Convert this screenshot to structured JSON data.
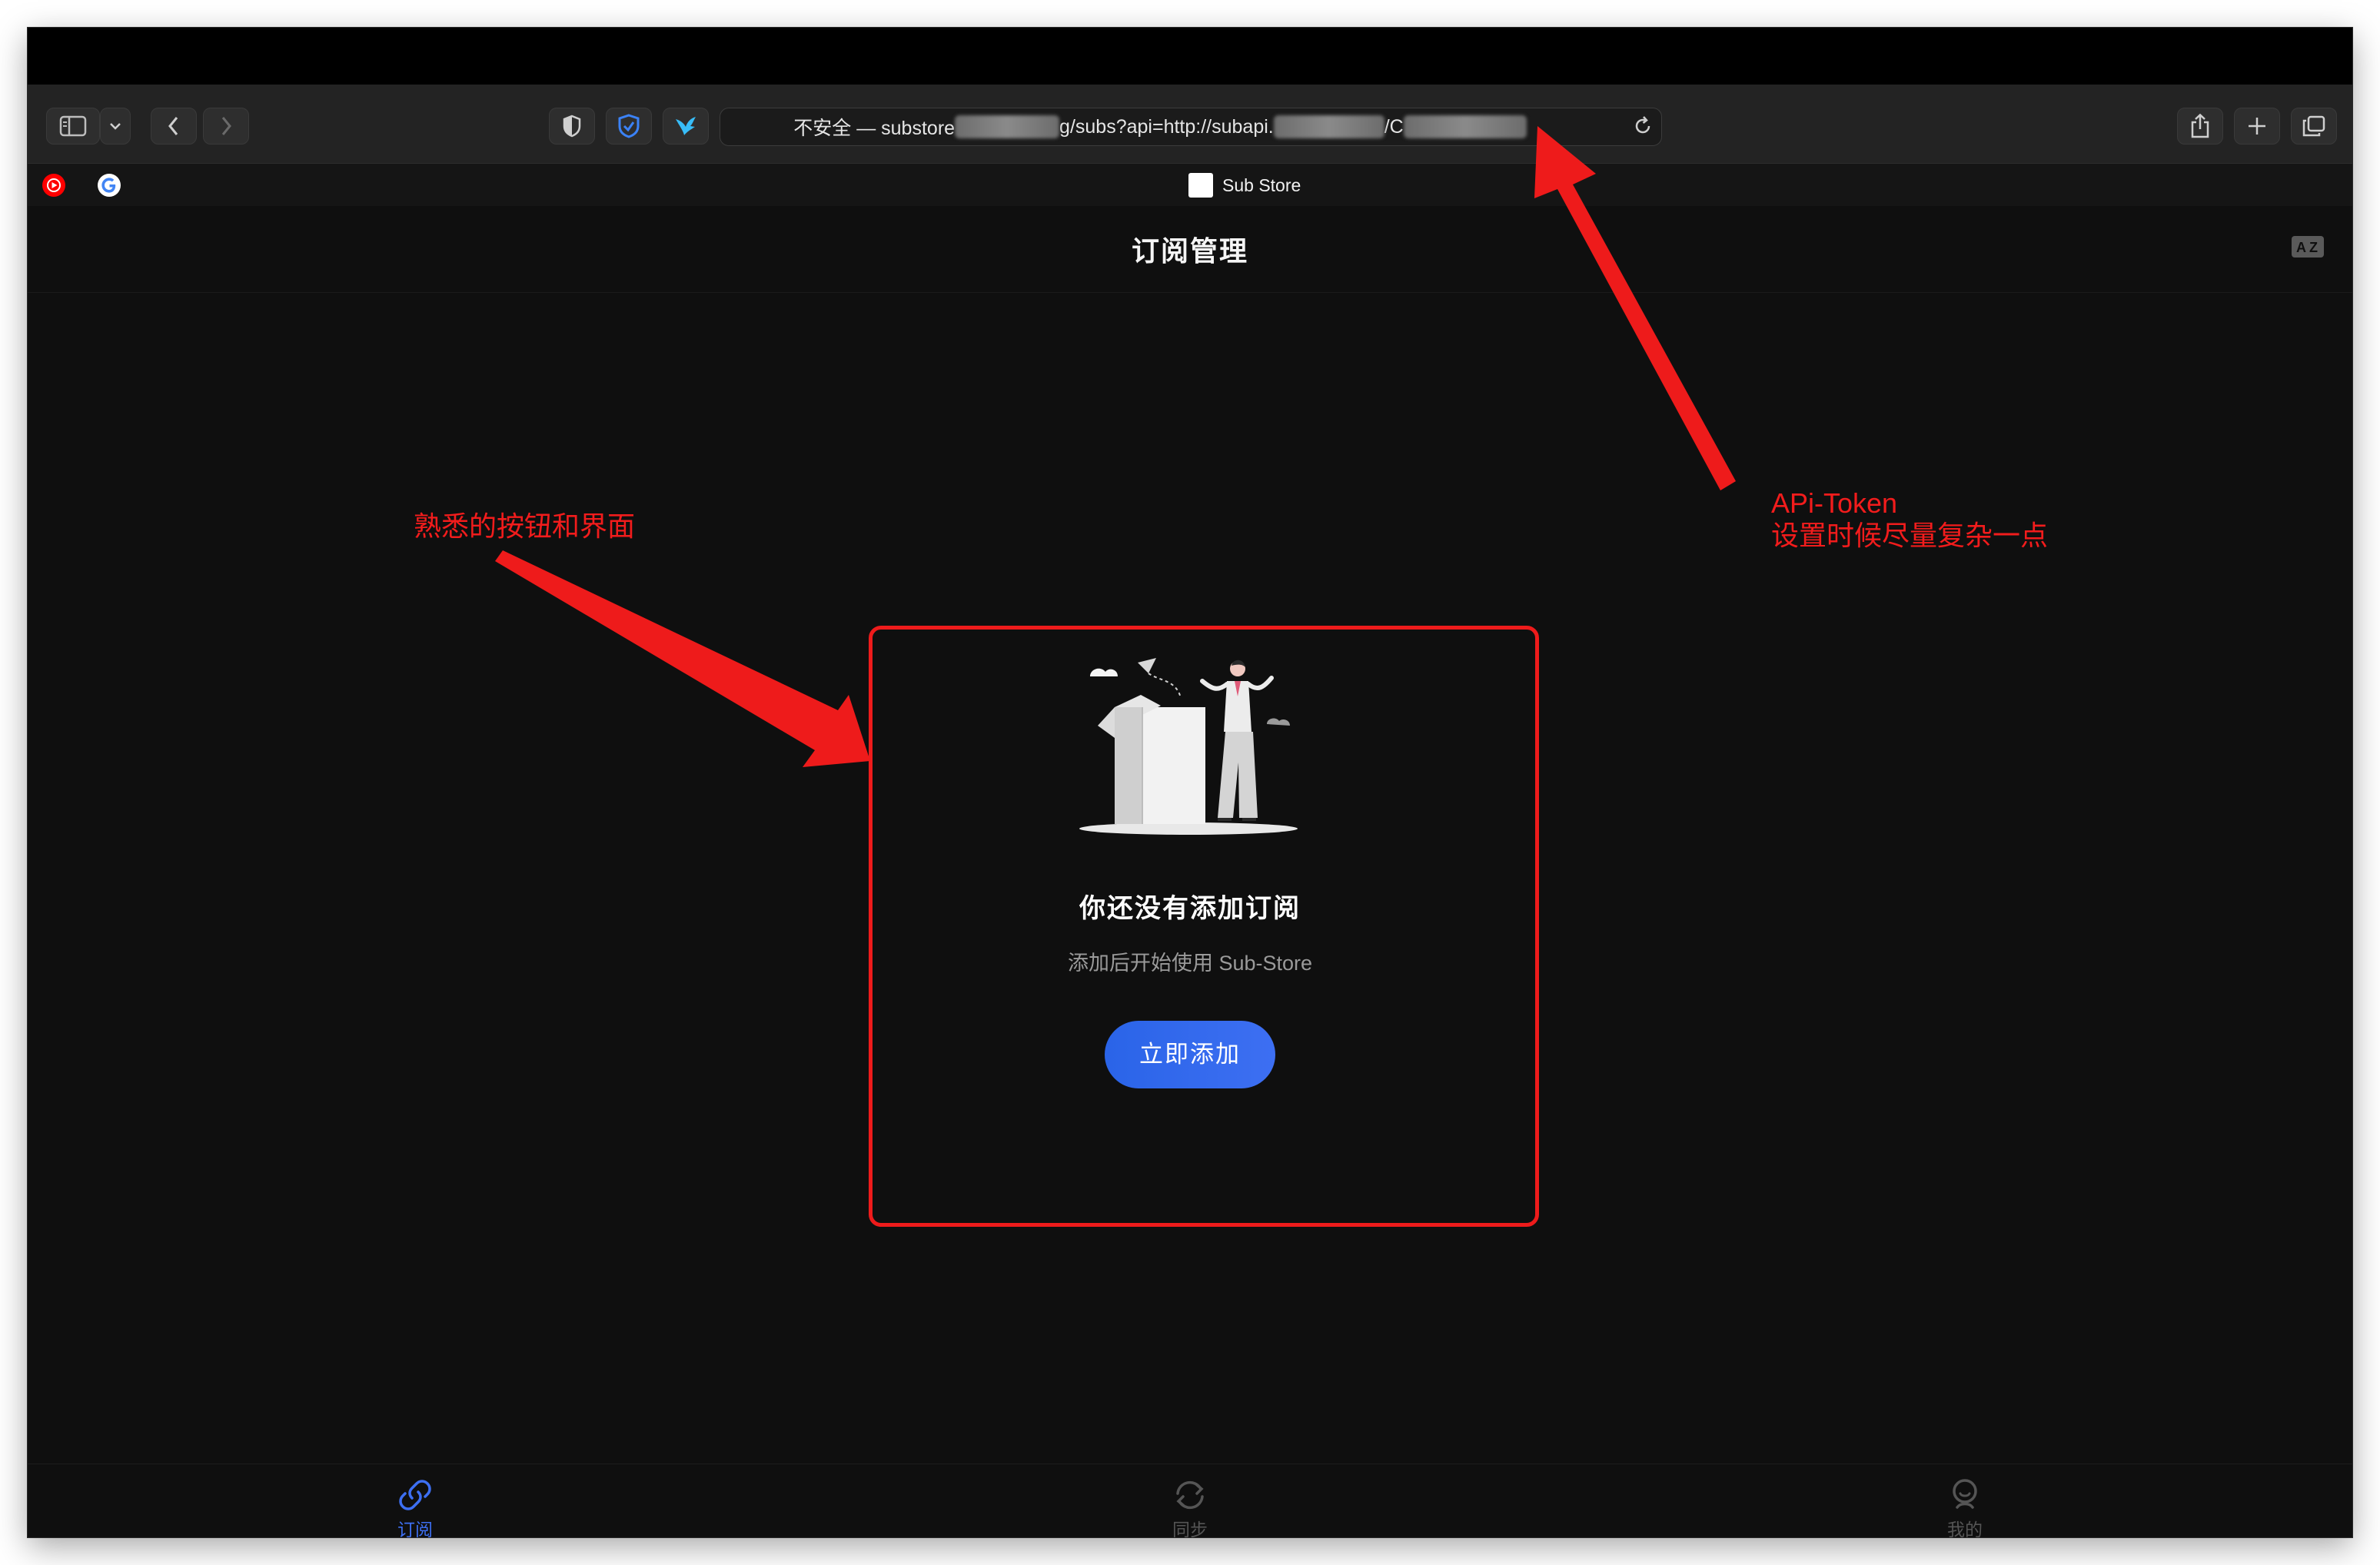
{
  "browser": {
    "url": {
      "security_label": "不安全 — substore",
      "part2": "g/subs?api=http://subapi.",
      "part3": "/C"
    },
    "tab_title": "Sub Store"
  },
  "app": {
    "title": "订阅管理",
    "empty_state": {
      "title": "你还没有添加订阅",
      "subtitle": "添加后开始使用 Sub-Store",
      "add_button": "立即添加"
    },
    "bottom_nav": [
      {
        "label": "订阅",
        "icon": "link-icon",
        "active": true
      },
      {
        "label": "同步",
        "icon": "sync-icon",
        "active": false
      },
      {
        "label": "我的",
        "icon": "profile-icon",
        "active": false
      }
    ]
  },
  "annotations": {
    "left_note": "熟悉的按钮和界面",
    "right_note_line1": "APi-Token",
    "right_note_line2": "设置时候尽量复杂一点"
  },
  "colors": {
    "accent": "#3d6ff2",
    "annotation": "#f21c1c",
    "background": "#0f0f0f"
  }
}
